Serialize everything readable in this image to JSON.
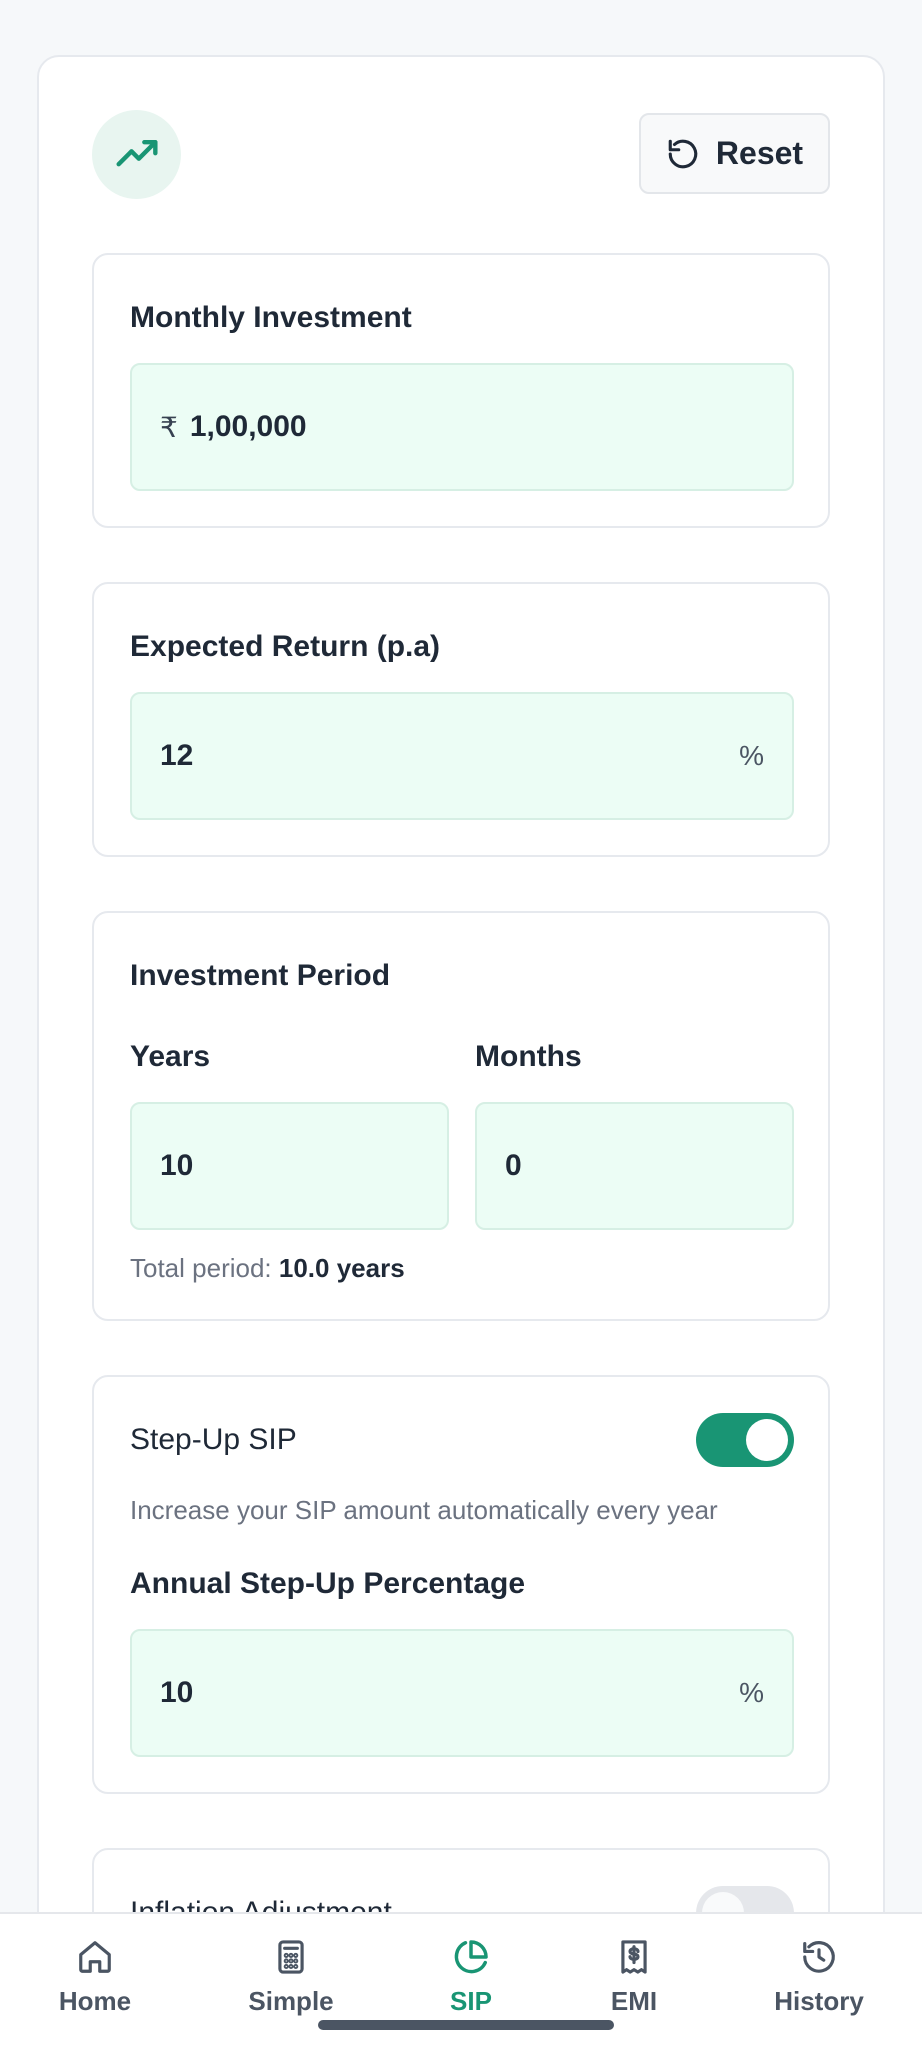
{
  "header": {
    "icon": "trending-up-icon",
    "reset_label": "Reset"
  },
  "monthly_investment": {
    "label": "Monthly Investment",
    "currency_symbol": "₹",
    "value": "1,00,000"
  },
  "expected_return": {
    "label": "Expected Return (p.a)",
    "value": "12",
    "suffix": "%"
  },
  "investment_period": {
    "label": "Investment Period",
    "years_label": "Years",
    "years_value": "10",
    "months_label": "Months",
    "months_value": "0",
    "total_prefix": "Total period:",
    "total_value": "10.0 years"
  },
  "step_up": {
    "label": "Step-Up SIP",
    "enabled": true,
    "description": "Increase your SIP amount automatically every year",
    "percentage_label": "Annual Step-Up Percentage",
    "percentage_value": "10",
    "suffix": "%"
  },
  "inflation": {
    "label": "Inflation Adjustment",
    "enabled": false
  },
  "nav": {
    "items": [
      {
        "label": "Home",
        "icon": "home-icon",
        "active": false
      },
      {
        "label": "Simple",
        "icon": "calculator-icon",
        "active": false
      },
      {
        "label": "SIP",
        "icon": "pie-chart-icon",
        "active": true
      },
      {
        "label": "EMI",
        "icon": "receipt-dollar-icon",
        "active": false
      },
      {
        "label": "History",
        "icon": "history-icon",
        "active": false
      }
    ]
  },
  "colors": {
    "accent": "#199574",
    "input_bg": "#ecfdf5",
    "icon_circle_bg": "#e8f5f0"
  }
}
